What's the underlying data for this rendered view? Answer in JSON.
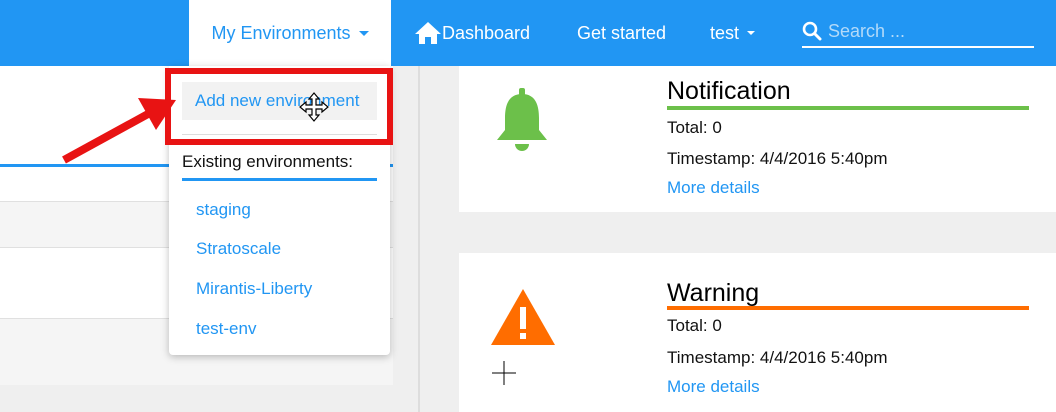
{
  "navbar": {
    "environments_label": "My Environments",
    "dashboard_label": "Dashboard",
    "get_started_label": "Get started",
    "user_label": "test",
    "search_placeholder": "Search ..."
  },
  "dropdown": {
    "add_new": "Add new environment",
    "existing_header": "Existing environments:",
    "items": [
      "staging",
      "Stratoscale",
      "Mirantis-Liberty",
      "test-env"
    ]
  },
  "cards": [
    {
      "title": "Notification",
      "total": "Total: 0",
      "timestamp": "Timestamp: 4/4/2016 5:40pm",
      "link": "More details",
      "color": "#6cc04a"
    },
    {
      "title": "Warning",
      "total": "Total: 0",
      "timestamp": "Timestamp: 4/4/2016 5:40pm",
      "link": "More details",
      "color": "#ff6d00"
    }
  ],
  "colors": {
    "primary": "#2196f3",
    "annotation": "#e81313"
  }
}
